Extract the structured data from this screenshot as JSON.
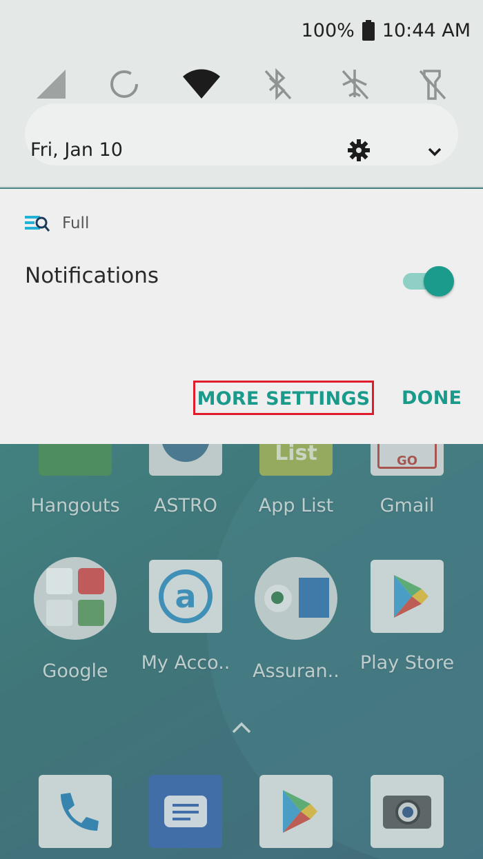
{
  "status_bar": {
    "battery_percent": "100%",
    "time": "10:44 AM"
  },
  "quick_settings": {
    "date": "Fri, Jan 10",
    "tiles": [
      "cellular-signal-icon",
      "auto-rotate-icon",
      "wifi-icon",
      "bluetooth-off-icon",
      "airplane-mode-off-icon",
      "flashlight-off-icon"
    ]
  },
  "notification_panel": {
    "app_name": "Full",
    "setting_label": "Notifications",
    "toggle_on": true,
    "more_settings_label": "MORE SETTINGS",
    "done_label": "DONE"
  },
  "home_screen": {
    "row1": [
      "Hangouts",
      "ASTRO",
      "App List",
      "Gmail"
    ],
    "row1_badges": {
      "app_list": "List",
      "gmail": "GO"
    },
    "row2": [
      "Google",
      "My Acco..",
      "Assuran..",
      "Play Store"
    ]
  },
  "colors": {
    "accent": "#1a9a8a",
    "highlight_box": "#e11c2a"
  }
}
